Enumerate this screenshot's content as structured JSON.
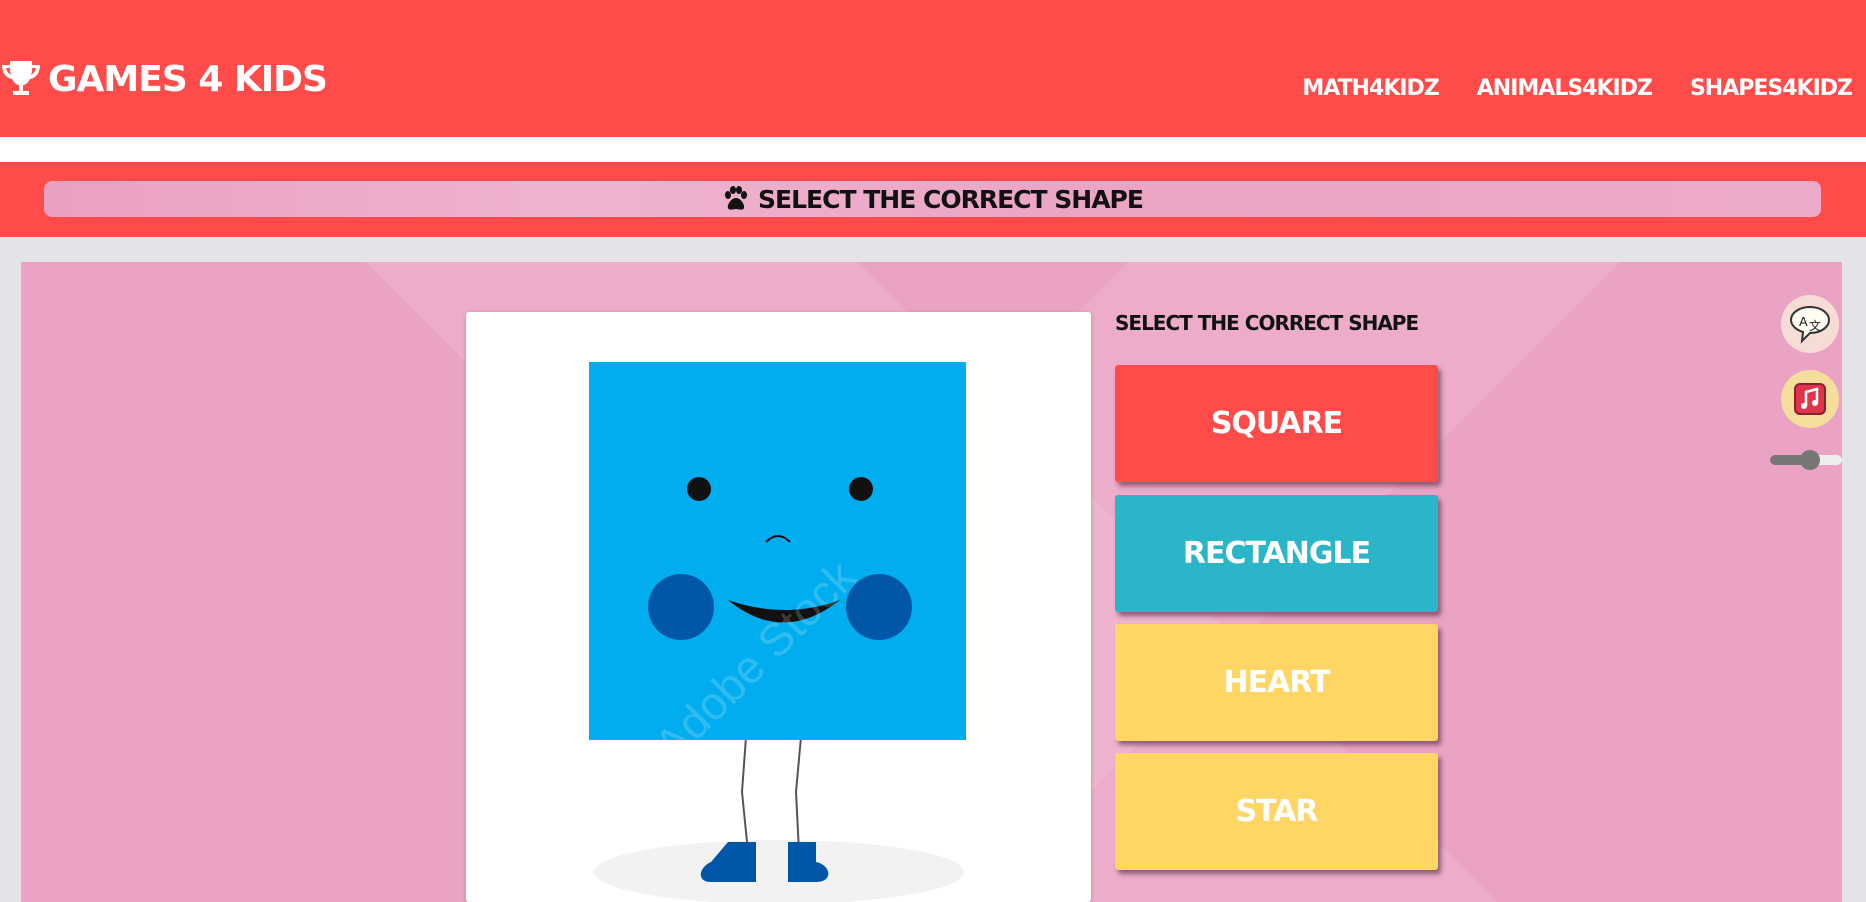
{
  "header": {
    "logo_text": "Games 4 Kids",
    "logo_icon": "trophy-icon",
    "nav": [
      "Math4Kidz",
      "Animals4Kidz",
      "Shapes4Kidz"
    ]
  },
  "titlebar": {
    "icon": "paw-icon",
    "text": "Select the correct shape"
  },
  "game": {
    "prompt": "Select the correct shape",
    "options": [
      {
        "label": "Square",
        "color": "#ff4b4a"
      },
      {
        "label": "Rectangle",
        "color": "#2ab5c9"
      },
      {
        "label": "Heart",
        "color": "#ffd666"
      },
      {
        "label": "Star",
        "color": "#ffd666"
      }
    ],
    "image_watermark": "Adobe Stock"
  },
  "controls": {
    "translate_icon": "translate-icon",
    "music_icon": "music-icon",
    "volume": 0.55
  },
  "colors": {
    "brand_red": "#ff4b4a",
    "panel_pink": "#eaa3c4",
    "square_blue": "#00aeef"
  }
}
